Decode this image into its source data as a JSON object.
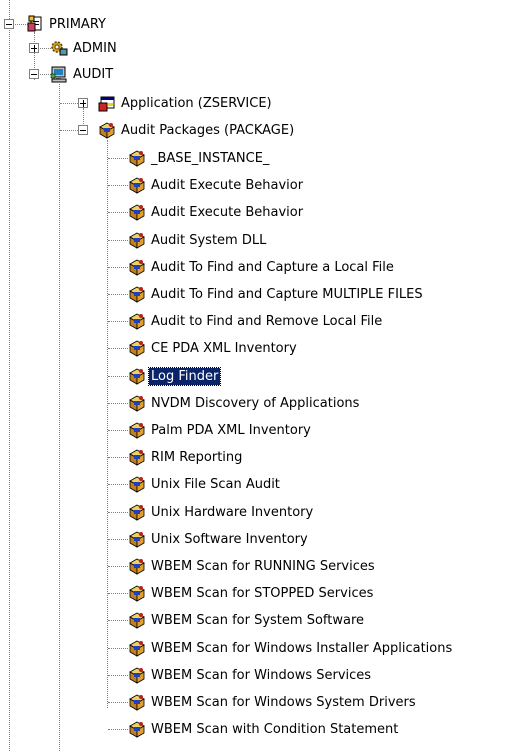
{
  "tree": {
    "root": {
      "label": "PRIMARY",
      "icon": "primary-file-icon",
      "children": [
        {
          "label": "ADMIN",
          "icon": "admin-gears-icon",
          "expanded": false
        },
        {
          "label": "AUDIT",
          "icon": "audit-computer-icon",
          "expanded": true
        }
      ]
    },
    "audit_children": [
      {
        "label": "Application (ZSERVICE)",
        "icon": "application-service-icon",
        "expanded": false
      },
      {
        "label": "Audit Packages (PACKAGE)",
        "icon": "package-icon",
        "expanded": true
      }
    ],
    "packages": [
      {
        "label": "_BASE_INSTANCE_",
        "icon": "package-icon"
      },
      {
        "label": "Audit Execute Behavior",
        "icon": "package-icon"
      },
      {
        "label": "Audit Execute Behavior",
        "icon": "package-icon"
      },
      {
        "label": "Audit System DLL",
        "icon": "package-icon"
      },
      {
        "label": "Audit To Find and Capture a Local File",
        "icon": "package-icon"
      },
      {
        "label": "Audit To Find and Capture MULTIPLE FILES",
        "icon": "package-icon"
      },
      {
        "label": "Audit to Find and Remove Local File",
        "icon": "package-icon"
      },
      {
        "label": "CE PDA XML Inventory",
        "icon": "package-icon"
      },
      {
        "label": "Log Finder",
        "icon": "package-icon",
        "selected": true
      },
      {
        "label": "NVDM Discovery of Applications",
        "icon": "package-icon"
      },
      {
        "label": "Palm PDA XML Inventory",
        "icon": "package-icon"
      },
      {
        "label": "RIM Reporting",
        "icon": "package-icon"
      },
      {
        "label": "Unix File Scan Audit",
        "icon": "package-icon"
      },
      {
        "label": "Unix Hardware Inventory",
        "icon": "package-icon"
      },
      {
        "label": "Unix Software Inventory",
        "icon": "package-icon"
      },
      {
        "label": "WBEM Scan for RUNNING Services",
        "icon": "package-icon"
      },
      {
        "label": "WBEM Scan for STOPPED Services",
        "icon": "package-icon"
      },
      {
        "label": "WBEM Scan for System Software",
        "icon": "package-icon"
      },
      {
        "label": "WBEM Scan for Windows Installer Applications",
        "icon": "package-icon"
      },
      {
        "label": "WBEM Scan for Windows Services",
        "icon": "package-icon"
      },
      {
        "label": "WBEM Scan for Windows System Drivers",
        "icon": "package-icon"
      },
      {
        "label": "WBEM Scan with Condition Statement",
        "icon": "package-icon"
      }
    ]
  },
  "colors": {
    "selection": "#0a246a",
    "connector": "#808080"
  }
}
